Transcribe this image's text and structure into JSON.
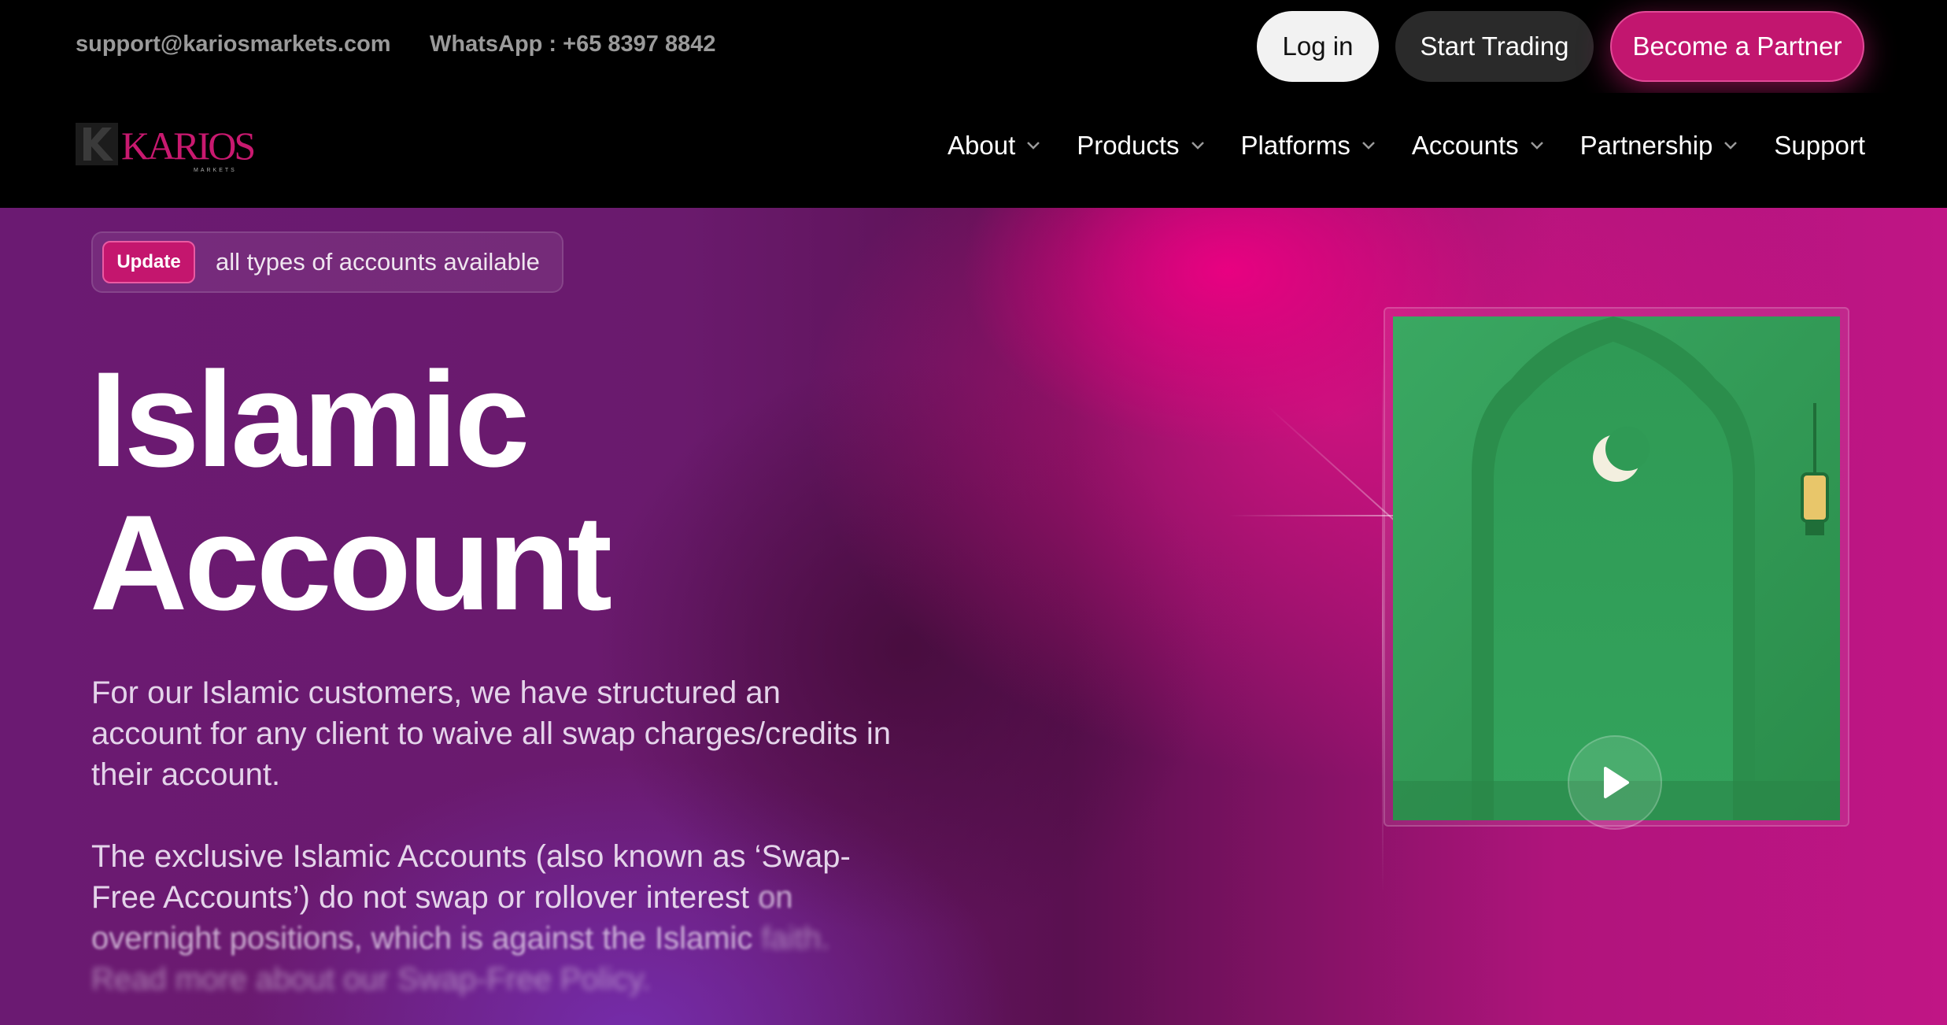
{
  "topbar": {
    "email": "support@kariosmarkets.com",
    "whatsapp": "WhatsApp : +65 8397 8842",
    "login_label": "Log in",
    "start_trading_label": "Start Trading",
    "become_partner_label": "Become a Partner"
  },
  "brand": {
    "logo_text": "KARIOS",
    "logo_subtext": "MARKETS",
    "accent_color": "#c2166f"
  },
  "nav": {
    "items": [
      {
        "label": "About",
        "has_dropdown": true
      },
      {
        "label": "Products",
        "has_dropdown": true
      },
      {
        "label": "Platforms",
        "has_dropdown": true
      },
      {
        "label": "Accounts",
        "has_dropdown": true
      },
      {
        "label": "Partnership",
        "has_dropdown": true
      },
      {
        "label": "Support",
        "has_dropdown": false
      }
    ]
  },
  "hero": {
    "badge": "Update",
    "badge_text": "all types of accounts available",
    "title_line1": "Islamic",
    "title_line2": "Account",
    "paragraph1": "For our Islamic customers, we have structured an account for any client to waive all swap charges/credits in their account.",
    "paragraph2_part1": "The exclusive Islamic Accounts (also known as ‘Swap-Free Accounts’) do not swap or rollover interest",
    "paragraph2_part2": "on overnight positions, which is against the Islamic",
    "paragraph2_part3": "faith. Read more about our Swap-Free Policy.",
    "video_icon": "play-icon"
  }
}
